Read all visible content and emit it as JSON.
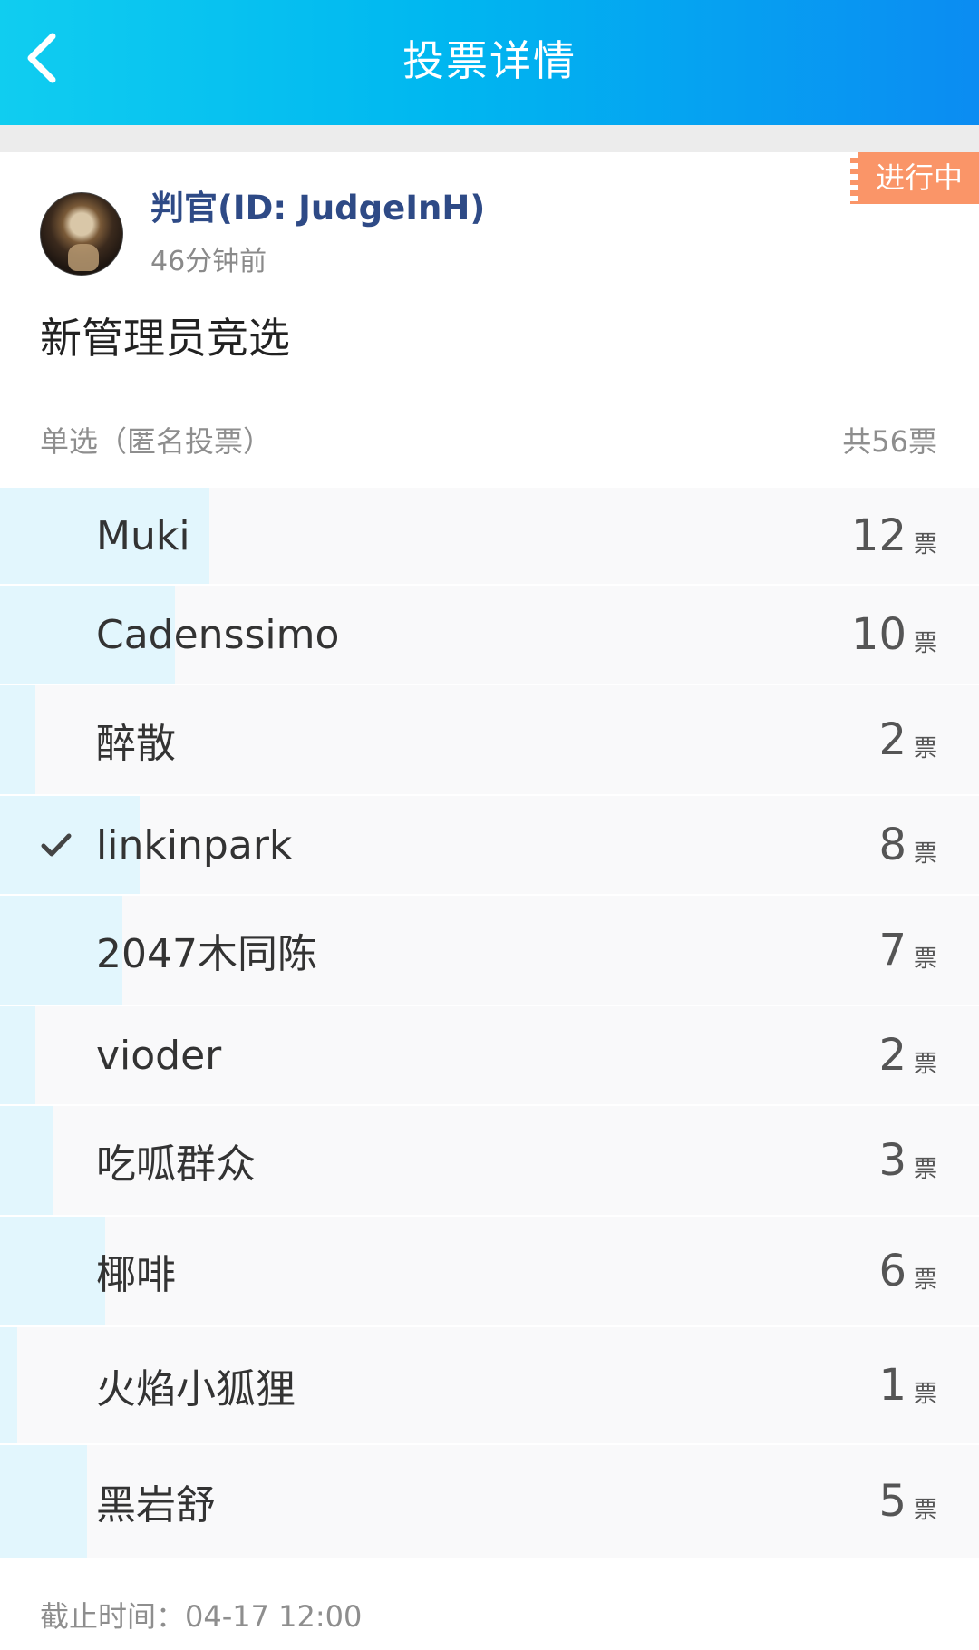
{
  "header": {
    "title": "投票详情",
    "back_icon": "chevron-left-icon",
    "gradient": [
      "#10cdf0",
      "#0b8cf2"
    ]
  },
  "post": {
    "status": "进行中",
    "status_color": "#fa9568",
    "author": "判官(ID: JudgeInH)",
    "time": "46分钟前",
    "title": "新管理员竞选"
  },
  "poll": {
    "type": "单选（匿名投票）",
    "total": "共56票",
    "unit": "票",
    "bar_color": "#e2f6fd",
    "options": [
      {
        "name": "Muki",
        "votes": "12",
        "share": 0.2143,
        "selected": false
      },
      {
        "name": "Cadenssimo",
        "votes": "10",
        "share": 0.1786,
        "selected": false
      },
      {
        "name": "醉散",
        "votes": "2",
        "share": 0.0357,
        "selected": false
      },
      {
        "name": "linkinpark",
        "votes": "8",
        "share": 0.1429,
        "selected": true
      },
      {
        "name": "2047木同陈",
        "votes": "7",
        "share": 0.125,
        "selected": false
      },
      {
        "name": "vioder",
        "votes": "2",
        "share": 0.0357,
        "selected": false
      },
      {
        "name": "吃呱群众",
        "votes": "3",
        "share": 0.0536,
        "selected": false
      },
      {
        "name": "椰啡",
        "votes": "6",
        "share": 0.1071,
        "selected": false
      },
      {
        "name": "火焰小狐狸",
        "votes": "1",
        "share": 0.0179,
        "selected": false
      },
      {
        "name": "黑岩舒",
        "votes": "5",
        "share": 0.0893,
        "selected": false
      }
    ]
  },
  "deadline": "截止时间：04-17 12:00"
}
